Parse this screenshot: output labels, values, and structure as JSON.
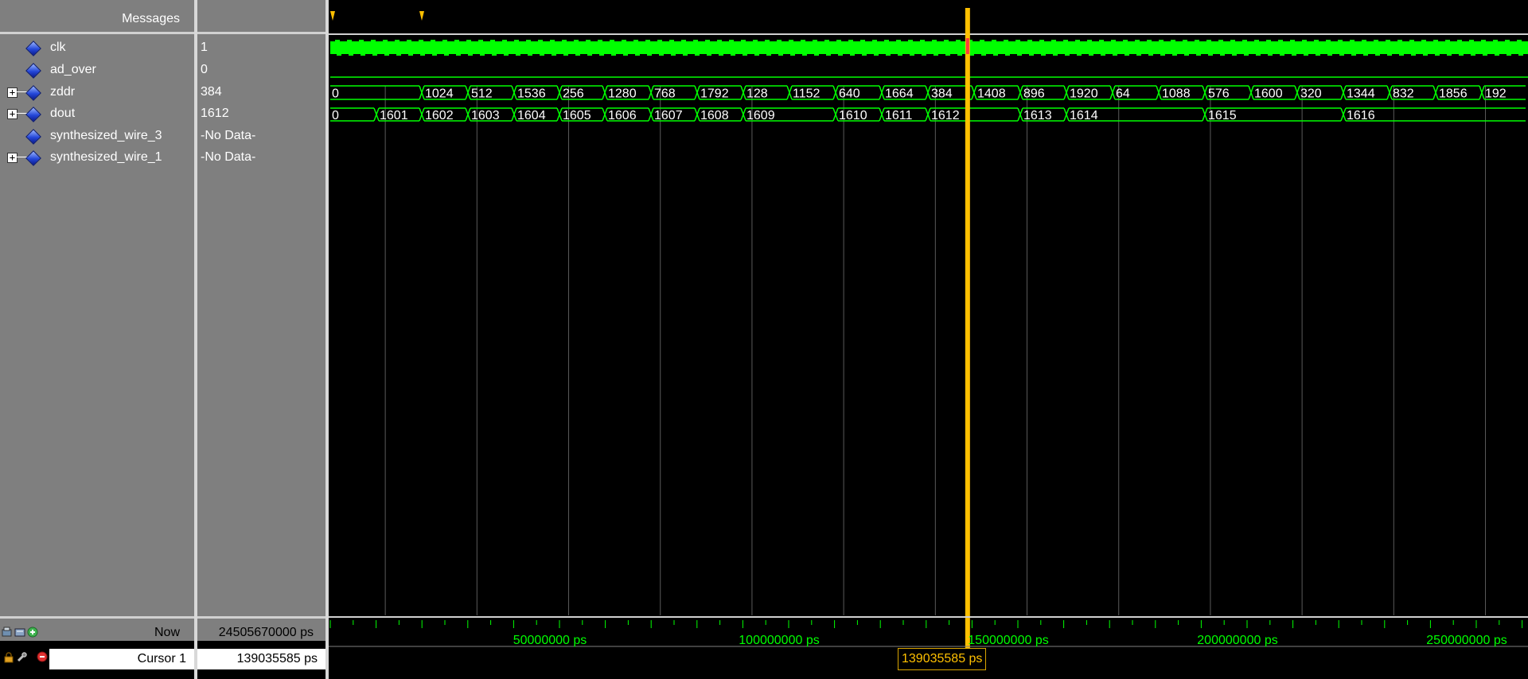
{
  "header": {
    "messages": "Messages"
  },
  "signals": [
    {
      "name": "clk",
      "value": "1",
      "expandable": false
    },
    {
      "name": "ad_over",
      "value": "0",
      "expandable": false
    },
    {
      "name": "zddr",
      "value": "384",
      "expandable": true
    },
    {
      "name": "dout",
      "value": "1612",
      "expandable": true
    },
    {
      "name": "synthesized_wire_3",
      "value": "-No Data-",
      "expandable": false
    },
    {
      "name": "synthesized_wire_1",
      "value": "-No Data-",
      "expandable": true
    }
  ],
  "footer": {
    "now_label": "Now",
    "now_value": "24505670000 ps",
    "cursor_label": "Cursor 1",
    "cursor_value": "139035585 ps"
  },
  "timeline": {
    "ticks": [
      "50000000 ps",
      "100000000 ps",
      "150000000 ps",
      "200000000 ps",
      "250000000 ps"
    ],
    "cursor_time": "139035585 ps"
  },
  "waves": {
    "zddr_values": [
      "0",
      "1024",
      "512",
      "1536",
      "256",
      "1280",
      "768",
      "1792",
      "128",
      "1152",
      "640",
      "1664",
      "384",
      "1408",
      "896",
      "1920",
      "64",
      "1088",
      "576",
      "1600",
      "320",
      "1344",
      "832",
      "1856",
      "192"
    ],
    "dout_values": [
      "0",
      "1601",
      "1602",
      "1603",
      "1604",
      "1605",
      "1606",
      "1607",
      "1608",
      "1609",
      "1610",
      "1611",
      "1612",
      "1613",
      "1614",
      "1615",
      "1616"
    ]
  },
  "colors": {
    "wave": "#00ff00",
    "grid": "#5a5a5a",
    "cursor": "#ffc000",
    "background": "#000000",
    "panel": "#7f7f7f"
  },
  "icons": [
    "diamond-signal-icon",
    "expand-icon",
    "zoom-icon",
    "add-cursor-icon",
    "lock-icon",
    "wrench-icon",
    "delete-cursor-icon",
    "marker-icon"
  ]
}
